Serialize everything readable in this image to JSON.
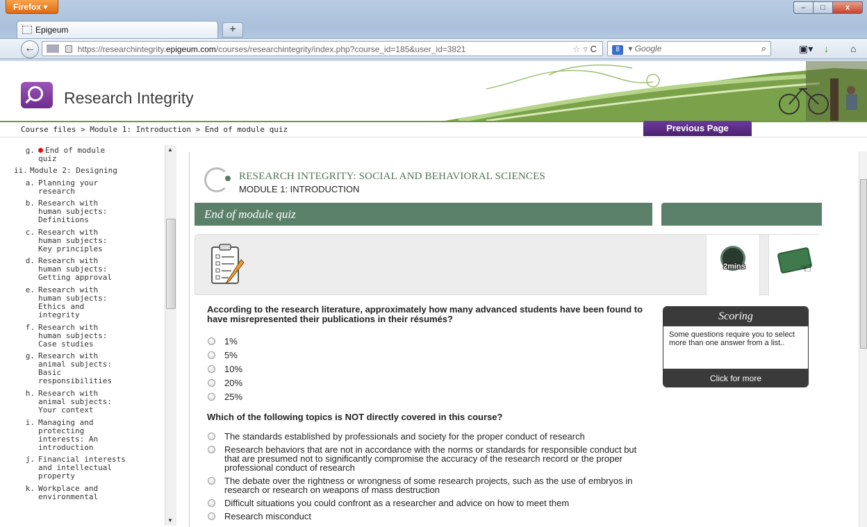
{
  "browser": {
    "app_button": "Firefox",
    "window_controls": [
      "–",
      "□",
      "x"
    ],
    "tab_title": "Epigeum",
    "new_tab": "+",
    "url_prefix": "https://researchintegrity.",
    "url_domain": "epigeum.com",
    "url_rest": "/courses/researchintegrity/index.php?course_id=185&user_id=3821",
    "search_placeholder": "Google",
    "search_engine": "8"
  },
  "header": {
    "site_title": "Research Integrity",
    "logo": "magnifier-icon"
  },
  "breadcrumb": {
    "text": "Course files > Module 1: Introduction > End of module quiz",
    "previous_page": "Previous Page"
  },
  "sidebar": {
    "items": [
      {
        "num": "g.",
        "text": [
          "End of module",
          "quiz"
        ],
        "current": true
      },
      {
        "num": "ii.",
        "text": [
          "Module 2: Designing"
        ],
        "top": true
      },
      {
        "num": "a.",
        "text": [
          "Planning your",
          "research"
        ]
      },
      {
        "num": "b.",
        "text": [
          "Research with",
          "human subjects:",
          "Definitions"
        ]
      },
      {
        "num": "c.",
        "text": [
          "Research with",
          "human subjects:",
          "Key principles"
        ]
      },
      {
        "num": "d.",
        "text": [
          "Research with",
          "human subjects:",
          "Getting approval"
        ]
      },
      {
        "num": "e.",
        "text": [
          "Research with",
          "human subjects:",
          "Ethics and",
          "integrity"
        ]
      },
      {
        "num": "f.",
        "text": [
          "Research with",
          "human subjects:",
          "Case studies"
        ]
      },
      {
        "num": "g.",
        "text": [
          "Research with",
          "animal subjects:",
          "Basic",
          "responsibilities"
        ]
      },
      {
        "num": "h.",
        "text": [
          "Research with",
          "animal subjects:",
          "Your context"
        ]
      },
      {
        "num": "i.",
        "text": [
          "Managing and",
          "protecting",
          "interests: An",
          "introduction"
        ]
      },
      {
        "num": "j.",
        "text": [
          "Financial interests",
          "and intellectual",
          "property"
        ]
      },
      {
        "num": "k.",
        "text": [
          "Workplace and",
          "environmental"
        ]
      }
    ]
  },
  "main": {
    "course_title": "RESEARCH INTEGRITY: SOCIAL AND BEHAVIORAL SCIENCES",
    "module_title": "MODULE 1: INTRODUCTION",
    "section_title": "End of module quiz",
    "timer_label": "2mins",
    "questions": [
      {
        "text": "According to the research literature, approximately how many advanced students have been found to have misrepresented their publications in their résumés?",
        "options": [
          "1%",
          "5%",
          "10%",
          "20%",
          "25%"
        ]
      },
      {
        "text": "Which of the following topics is NOT directly covered in this course?",
        "options": [
          "The standards established by professionals and society for the proper conduct of research",
          "Research behaviors that are not in accordance with the norms or standards for responsible conduct but that are presumed not to significantly compromise the accuracy of the research record or the proper professional conduct of research",
          "The debate over the rightness or wrongness of some research projects, such as the use of embryos in research or research on weapons of mass destruction",
          "Difficult situations you could confront as a researcher and advice on how to meet them",
          "Research misconduct"
        ]
      }
    ],
    "scoring": {
      "title": "Scoring",
      "body": "Some questions require you to select more than one answer from a list..",
      "footer": "Click for more"
    }
  },
  "colors": {
    "accent_green": "#5b806a",
    "brand_purple": "#6d2d8e",
    "firefox_orange": "#e06a12"
  }
}
